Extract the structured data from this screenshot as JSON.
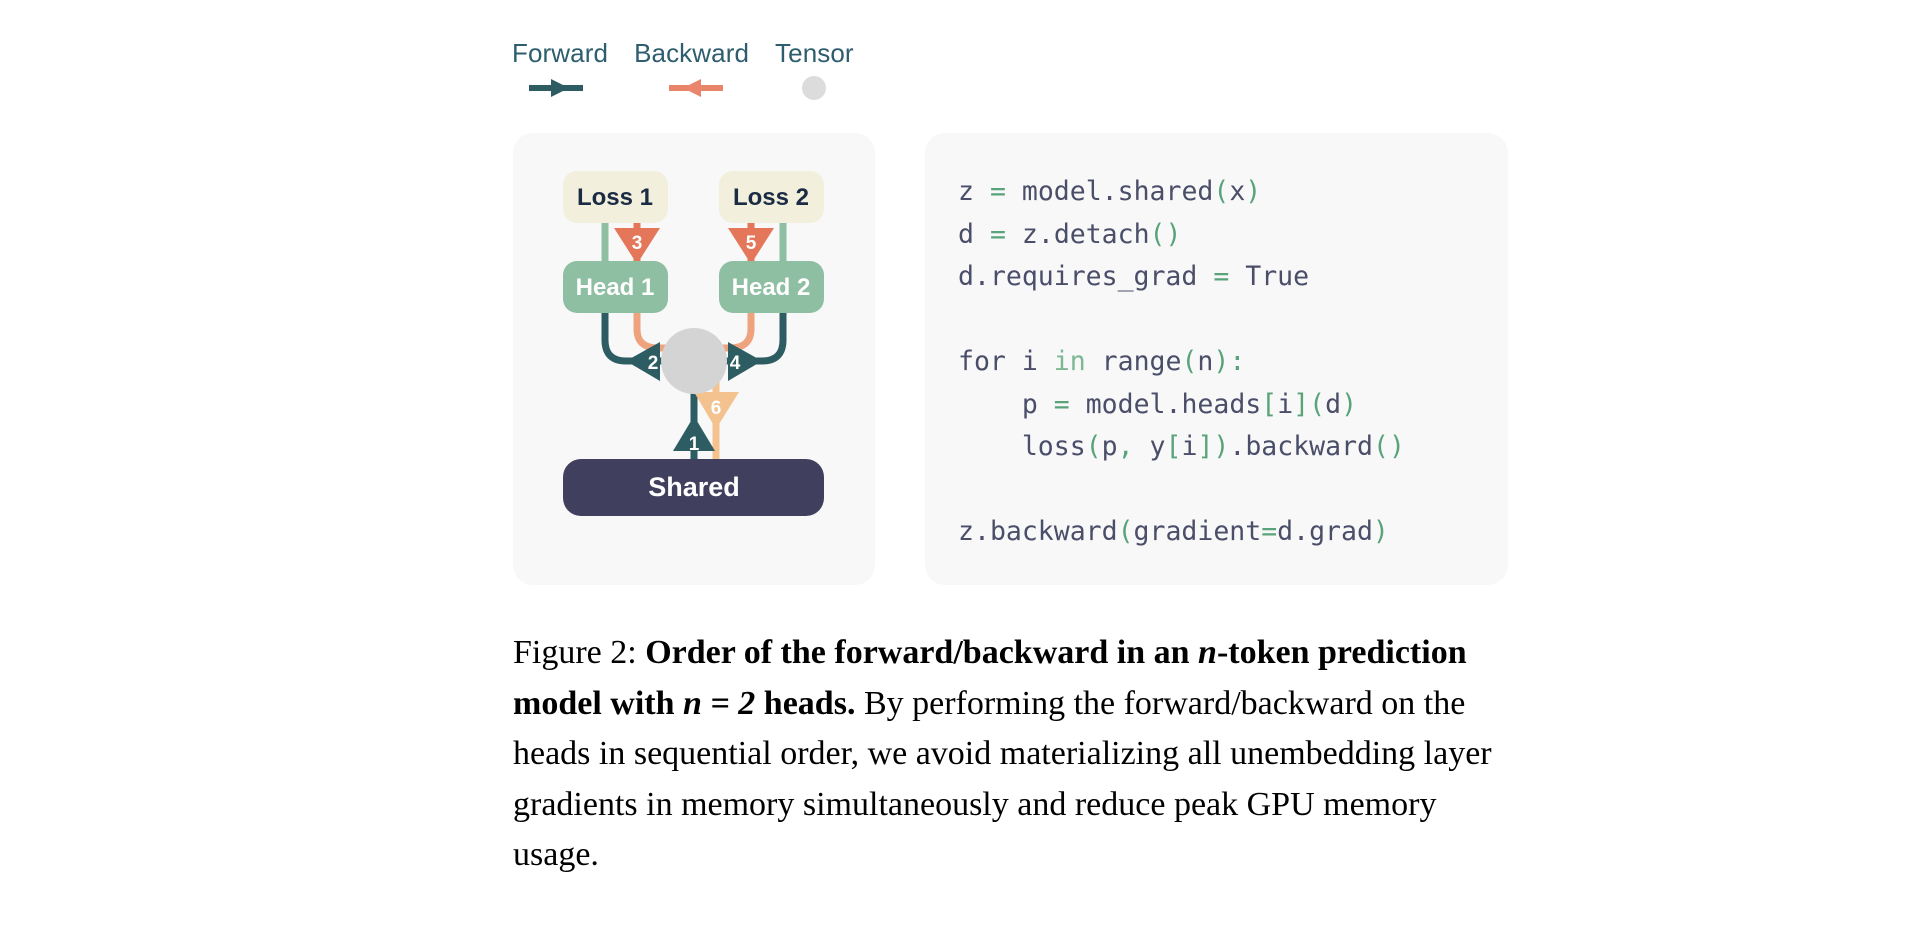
{
  "legend": {
    "items": [
      {
        "label": "Forward",
        "icon": "arrow-right-icon",
        "color": "#2d5d62"
      },
      {
        "label": "Backward",
        "icon": "arrow-left-icon",
        "color": "#e8856a"
      },
      {
        "label": "Tensor",
        "icon": "circle-icon",
        "color": "#d9d9d9"
      }
    ]
  },
  "diagram": {
    "nodes": {
      "loss1": {
        "label": "Loss 1",
        "fill": "#f2efdc",
        "text_color": "#1b2b44"
      },
      "loss2": {
        "label": "Loss 2",
        "fill": "#f2efdc",
        "text_color": "#1b2b44"
      },
      "head1": {
        "label": "Head 1",
        "fill": "#8fbfa3",
        "text_color": "#ffffff"
      },
      "head2": {
        "label": "Head 2",
        "fill": "#8fbfa3",
        "text_color": "#ffffff"
      },
      "shared": {
        "label": "Shared",
        "fill": "#413f5e",
        "text_color": "#ffffff"
      },
      "tensor": {
        "label": "",
        "fill": "#d4d4d4",
        "text_color": "#ffffff"
      }
    },
    "steps": [
      {
        "number": "1",
        "from": "shared",
        "to": "tensor",
        "kind": "forward",
        "color": "#2d5d62"
      },
      {
        "number": "2",
        "from": "tensor",
        "to": "head1",
        "kind": "forward",
        "color": "#2d5d62"
      },
      {
        "number": "3",
        "from": "loss1",
        "to": "head1",
        "kind": "backward",
        "color": "#e4765a"
      },
      {
        "number": "4",
        "from": "tensor",
        "to": "head2",
        "kind": "forward",
        "color": "#2d5d62"
      },
      {
        "number": "5",
        "from": "loss2",
        "to": "head2",
        "kind": "backward",
        "color": "#e4765a"
      },
      {
        "number": "6",
        "from": "tensor",
        "to": "shared",
        "kind": "backward",
        "color": "#f3c28f"
      }
    ]
  },
  "code": {
    "lines": [
      [
        {
          "t": "z",
          "c": "id"
        },
        {
          "t": " "
        },
        {
          "t": "=",
          "c": "op"
        },
        {
          "t": " "
        },
        {
          "t": "model",
          "c": "id"
        },
        {
          "t": ".",
          "c": "id"
        },
        {
          "t": "shared",
          "c": "id"
        },
        {
          "t": "(",
          "c": "pn"
        },
        {
          "t": "x",
          "c": "id"
        },
        {
          "t": ")",
          "c": "pn"
        }
      ],
      [
        {
          "t": "d",
          "c": "id"
        },
        {
          "t": " "
        },
        {
          "t": "=",
          "c": "op"
        },
        {
          "t": " "
        },
        {
          "t": "z",
          "c": "id"
        },
        {
          "t": ".",
          "c": "id"
        },
        {
          "t": "detach",
          "c": "id"
        },
        {
          "t": "(",
          "c": "pn"
        },
        {
          "t": ")",
          "c": "pn"
        }
      ],
      [
        {
          "t": "d",
          "c": "id"
        },
        {
          "t": ".",
          "c": "id"
        },
        {
          "t": "requires_grad",
          "c": "id"
        },
        {
          "t": " "
        },
        {
          "t": "=",
          "c": "op"
        },
        {
          "t": " "
        },
        {
          "t": "True",
          "c": "id"
        }
      ],
      [],
      [
        {
          "t": "for",
          "c": "id"
        },
        {
          "t": " "
        },
        {
          "t": "i",
          "c": "id"
        },
        {
          "t": " "
        },
        {
          "t": "in",
          "c": "kw"
        },
        {
          "t": " "
        },
        {
          "t": "range",
          "c": "id"
        },
        {
          "t": "(",
          "c": "pn"
        },
        {
          "t": "n",
          "c": "id"
        },
        {
          "t": ")",
          "c": "pn"
        },
        {
          "t": ":",
          "c": "pn"
        }
      ],
      [
        {
          "t": "    "
        },
        {
          "t": "p",
          "c": "id"
        },
        {
          "t": " "
        },
        {
          "t": "=",
          "c": "op"
        },
        {
          "t": " "
        },
        {
          "t": "model",
          "c": "id"
        },
        {
          "t": ".",
          "c": "id"
        },
        {
          "t": "heads",
          "c": "id"
        },
        {
          "t": "[",
          "c": "pn"
        },
        {
          "t": "i",
          "c": "id"
        },
        {
          "t": "]",
          "c": "pn"
        },
        {
          "t": "(",
          "c": "pn"
        },
        {
          "t": "d",
          "c": "id"
        },
        {
          "t": ")",
          "c": "pn"
        }
      ],
      [
        {
          "t": "    "
        },
        {
          "t": "loss",
          "c": "id"
        },
        {
          "t": "(",
          "c": "pn"
        },
        {
          "t": "p",
          "c": "id"
        },
        {
          "t": ",",
          "c": "pn"
        },
        {
          "t": " "
        },
        {
          "t": "y",
          "c": "id"
        },
        {
          "t": "[",
          "c": "pn"
        },
        {
          "t": "i",
          "c": "id"
        },
        {
          "t": "]",
          "c": "pn"
        },
        {
          "t": ")",
          "c": "pn"
        },
        {
          "t": ".",
          "c": "id"
        },
        {
          "t": "backward",
          "c": "id"
        },
        {
          "t": "(",
          "c": "pn"
        },
        {
          "t": ")",
          "c": "pn"
        }
      ],
      [],
      [
        {
          "t": "z",
          "c": "id"
        },
        {
          "t": ".",
          "c": "id"
        },
        {
          "t": "backward",
          "c": "id"
        },
        {
          "t": "(",
          "c": "pn"
        },
        {
          "t": "gradient",
          "c": "id"
        },
        {
          "t": "=",
          "c": "op"
        },
        {
          "t": "d",
          "c": "id"
        },
        {
          "t": ".",
          "c": "id"
        },
        {
          "t": "grad",
          "c": "id"
        },
        {
          "t": ")",
          "c": "pn"
        }
      ]
    ],
    "plain_text": "z = model.shared(x)\nd = z.detach()\nd.requires_grad = True\n\nfor i in range(n):\n    p = model.heads[i](d)\n    loss(p, y[i]).backward()\n\nz.backward(gradient=d.grad)"
  },
  "caption": {
    "figure_number": "Figure 2:",
    "title_part1": "Order of the forward/backward in an ",
    "title_math_n1": "n",
    "title_part2": "-token prediction model with ",
    "title_math_eq": "n = 2",
    "title_part3": " heads.",
    "body": " By performing the forward/backward on the heads in sequential order, we avoid materializing all unembedding layer gradients in memory simultaneously and reduce peak GPU memory usage.",
    "full_text": "Figure 2: Order of the forward/backward in an n-token prediction model with n = 2 heads. By performing the forward/backward on the heads in sequential order, we avoid materializing all unembedding layer gradients in memory simultaneously and reduce peak GPU memory usage."
  }
}
